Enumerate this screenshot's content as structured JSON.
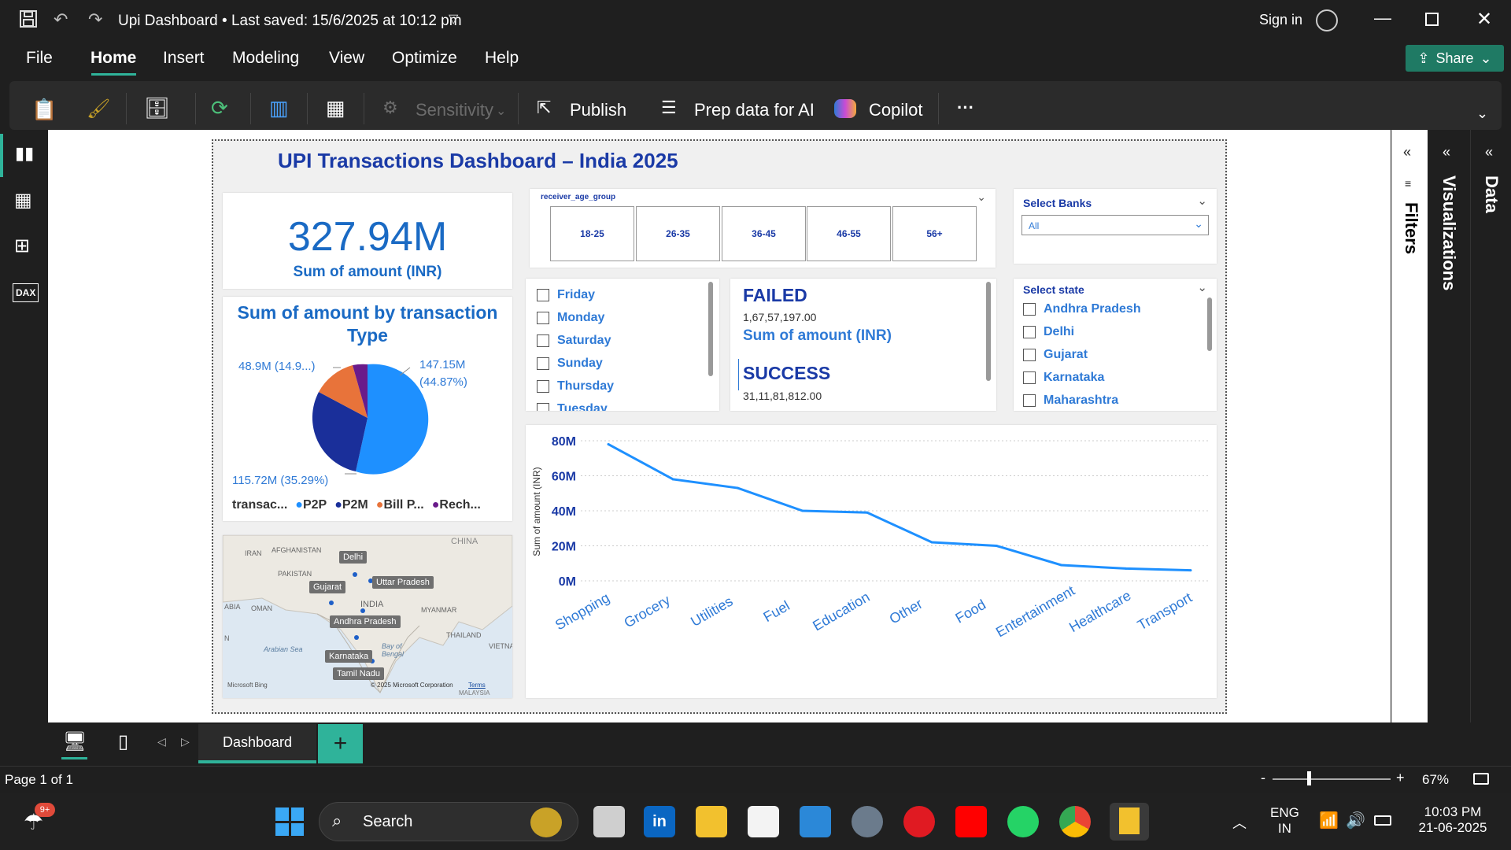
{
  "window": {
    "title": "Upi Dashboard",
    "saved": "• Last saved: 15/6/2025 at 10:12 pm",
    "signin": "Sign in"
  },
  "menu": {
    "file": "File",
    "home": "Home",
    "insert": "Insert",
    "modeling": "Modeling",
    "view": "View",
    "optimize": "Optimize",
    "help": "Help",
    "share": "Share"
  },
  "ribbon": {
    "sensitivity": "Sensitivity",
    "publish": "Publish",
    "prep": "Prep data for AI",
    "copilot": "Copilot",
    "more": "···"
  },
  "report": {
    "title": "UPI Transactions Dashboard – India 2025",
    "kpi": {
      "value": "327.94M",
      "label": "Sum of amount (INR)"
    },
    "pie": {
      "title": "Sum of amount by transaction Type",
      "lbl_p2p": "147.15M (44.87%)",
      "lbl_p2m": "115.72M (35.29%)",
      "lbl_bill": "48.9M (14.9...)",
      "legend_title": "transac...",
      "legend": [
        "P2P",
        "P2M",
        "Bill P...",
        "Rech..."
      ]
    },
    "age": {
      "title": "receiver_age_group",
      "groups": [
        "18-25",
        "26-35",
        "36-45",
        "46-55",
        "56+"
      ]
    },
    "banks": {
      "title": "Select Banks",
      "value": "All"
    },
    "days": {
      "items": [
        "Friday",
        "Monday",
        "Saturday",
        "Sunday",
        "Thursday"
      ],
      "cut": "Tuesday"
    },
    "status": {
      "failed_title": "FAILED",
      "failed_value": "1,67,57,197.00",
      "failed_label": "Sum of amount (INR)",
      "success_title": "SUCCESS",
      "success_value": "31,11,81,812.00"
    },
    "state": {
      "title": "Select state",
      "items": [
        "Andhra Pradesh",
        "Delhi",
        "Gujarat",
        "Karnataka",
        "Maharashtra"
      ]
    },
    "map": {
      "labels": {
        "delhi": "Delhi",
        "gujarat": "Gujarat",
        "up": "Uttar Pradesh",
        "ap": "Andhra Pradesh",
        "ka": "Karnataka",
        "tn": "Tamil Nadu"
      },
      "geo": {
        "iran": "IRAN",
        "afg": "AFGHANISTAN",
        "pak": "PAKISTAN",
        "india": "INDIA",
        "oman": "OMAN",
        "myanmar": "MYANMAR",
        "thailand": "THAILAND",
        "china": "CHINA",
        "arabian": "Arabian Sea",
        "bay": "Bay of Bengal",
        "abia": "ABIA",
        "vietna": "VIETNA",
        "malaysia": "MALAYSIA",
        "n": "N"
      },
      "bing": "Microsoft Bing",
      "copyright": "© 2025 Microsoft Corporation",
      "terms": "Terms"
    }
  },
  "chart_data": {
    "type": "line",
    "ylabel": "Sum of amount (INR)",
    "categories": [
      "Shopping",
      "Grocery",
      "Utilities",
      "Fuel",
      "Education",
      "Other",
      "Food",
      "Entertainment",
      "Healthcare",
      "Transport"
    ],
    "values": [
      78,
      58,
      53,
      40,
      39,
      22,
      20,
      9,
      7,
      6
    ],
    "ylim": [
      0,
      80
    ],
    "yticks": [
      "0M",
      "20M",
      "40M",
      "60M",
      "80M"
    ],
    "color": "#1e90ff"
  },
  "panes": {
    "filters": "Filters",
    "visualizations": "Visualizations",
    "data": "Data"
  },
  "pages": {
    "tab": "Dashboard",
    "add": "+"
  },
  "status": {
    "page": "Page 1 of 1",
    "zoom": "67%",
    "minus": "-",
    "plus": "+"
  },
  "taskbar": {
    "search": "Search",
    "lang1": "ENG",
    "lang2": "IN",
    "time": "10:03 PM",
    "date": "21-06-2025",
    "badge": "9+"
  }
}
